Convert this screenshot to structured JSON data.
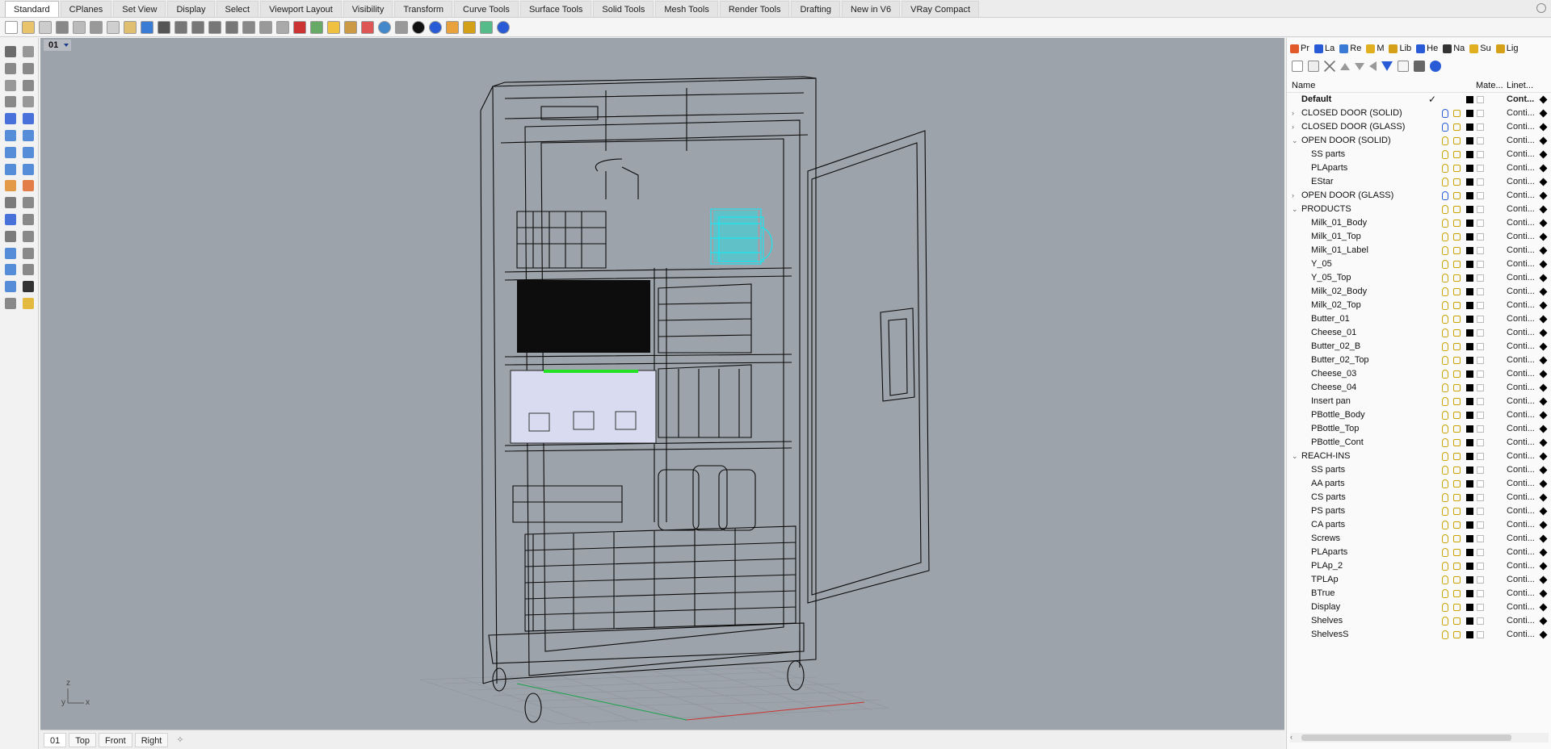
{
  "menu_tabs": [
    "Standard",
    "CPlanes",
    "Set View",
    "Display",
    "Select",
    "Viewport Layout",
    "Visibility",
    "Transform",
    "Curve Tools",
    "Surface Tools",
    "Solid Tools",
    "Mesh Tools",
    "Render Tools",
    "Drafting",
    "New in V6",
    "VRay Compact"
  ],
  "active_menu_tab": "Standard",
  "viewport": {
    "title": "01",
    "axis_z": "z",
    "axis_y": "y",
    "axis_x": "x"
  },
  "viewport_tabs": [
    "01",
    "Top",
    "Front",
    "Right"
  ],
  "panel": {
    "tabs": [
      "Pr",
      "La",
      "Re",
      "M",
      "Lib",
      "He",
      "Na",
      "Su",
      "Lig"
    ],
    "columns": {
      "name": "Name",
      "material": "Mate...",
      "linetype": "Linet..."
    },
    "layers": [
      {
        "name": "Default",
        "indent": 0,
        "current": true,
        "bold": true,
        "linetype": "Cont...",
        "expander": "",
        "bulb": "none"
      },
      {
        "name": "CLOSED DOOR (SOLID)",
        "indent": 0,
        "linetype": "Conti...",
        "expander": "›",
        "bulb": "blue"
      },
      {
        "name": "CLOSED DOOR (GLASS)",
        "indent": 0,
        "linetype": "Conti...",
        "expander": "›",
        "bulb": "blue"
      },
      {
        "name": "OPEN DOOR (SOLID)",
        "indent": 0,
        "linetype": "Conti...",
        "expander": "⌄",
        "bulb": "yellow"
      },
      {
        "name": "SS parts",
        "indent": 1,
        "linetype": "Conti...",
        "expander": "",
        "bulb": "yellow"
      },
      {
        "name": "PLAparts",
        "indent": 1,
        "linetype": "Conti...",
        "expander": "",
        "bulb": "yellow"
      },
      {
        "name": "EStar",
        "indent": 1,
        "linetype": "Conti...",
        "expander": "",
        "bulb": "yellow"
      },
      {
        "name": "OPEN DOOR (GLASS)",
        "indent": 0,
        "linetype": "Conti...",
        "expander": "›",
        "bulb": "blue"
      },
      {
        "name": "PRODUCTS",
        "indent": 0,
        "linetype": "Conti...",
        "expander": "⌄",
        "bulb": "yellow"
      },
      {
        "name": "Milk_01_Body",
        "indent": 1,
        "linetype": "Conti...",
        "expander": "",
        "bulb": "yellow"
      },
      {
        "name": "Milk_01_Top",
        "indent": 1,
        "linetype": "Conti...",
        "expander": "",
        "bulb": "yellow"
      },
      {
        "name": "Milk_01_Label",
        "indent": 1,
        "linetype": "Conti...",
        "expander": "",
        "bulb": "yellow"
      },
      {
        "name": "Y_05",
        "indent": 1,
        "linetype": "Conti...",
        "expander": "",
        "bulb": "yellow"
      },
      {
        "name": "Y_05_Top",
        "indent": 1,
        "linetype": "Conti...",
        "expander": "",
        "bulb": "yellow"
      },
      {
        "name": "Milk_02_Body",
        "indent": 1,
        "linetype": "Conti...",
        "expander": "",
        "bulb": "yellow"
      },
      {
        "name": "Milk_02_Top",
        "indent": 1,
        "linetype": "Conti...",
        "expander": "",
        "bulb": "yellow"
      },
      {
        "name": "Butter_01",
        "indent": 1,
        "linetype": "Conti...",
        "expander": "",
        "bulb": "yellow"
      },
      {
        "name": "Cheese_01",
        "indent": 1,
        "linetype": "Conti...",
        "expander": "",
        "bulb": "yellow"
      },
      {
        "name": "Butter_02_B",
        "indent": 1,
        "linetype": "Conti...",
        "expander": "",
        "bulb": "yellow"
      },
      {
        "name": "Butter_02_Top",
        "indent": 1,
        "linetype": "Conti...",
        "expander": "",
        "bulb": "yellow"
      },
      {
        "name": "Cheese_03",
        "indent": 1,
        "linetype": "Conti...",
        "expander": "",
        "bulb": "yellow"
      },
      {
        "name": "Cheese_04",
        "indent": 1,
        "linetype": "Conti...",
        "expander": "",
        "bulb": "yellow"
      },
      {
        "name": "Insert pan",
        "indent": 1,
        "linetype": "Conti...",
        "expander": "",
        "bulb": "yellow"
      },
      {
        "name": "PBottle_Body",
        "indent": 1,
        "linetype": "Conti...",
        "expander": "",
        "bulb": "yellow"
      },
      {
        "name": "PBottle_Top",
        "indent": 1,
        "linetype": "Conti...",
        "expander": "",
        "bulb": "yellow"
      },
      {
        "name": "PBottle_Cont",
        "indent": 1,
        "linetype": "Conti...",
        "expander": "",
        "bulb": "yellow"
      },
      {
        "name": "REACH-INS",
        "indent": 0,
        "linetype": "Conti...",
        "expander": "⌄",
        "bulb": "yellow"
      },
      {
        "name": "SS parts",
        "indent": 1,
        "linetype": "Conti...",
        "expander": "",
        "bulb": "yellow"
      },
      {
        "name": "AA parts",
        "indent": 1,
        "linetype": "Conti...",
        "expander": "",
        "bulb": "yellow"
      },
      {
        "name": "CS parts",
        "indent": 1,
        "linetype": "Conti...",
        "expander": "",
        "bulb": "yellow"
      },
      {
        "name": "PS parts",
        "indent": 1,
        "linetype": "Conti...",
        "expander": "",
        "bulb": "yellow"
      },
      {
        "name": "CA parts",
        "indent": 1,
        "linetype": "Conti...",
        "expander": "",
        "bulb": "yellow"
      },
      {
        "name": "Screws",
        "indent": 1,
        "linetype": "Conti...",
        "expander": "",
        "bulb": "yellow"
      },
      {
        "name": "PLAparts",
        "indent": 1,
        "linetype": "Conti...",
        "expander": "",
        "bulb": "yellow"
      },
      {
        "name": "PLAp_2",
        "indent": 1,
        "linetype": "Conti...",
        "expander": "",
        "bulb": "yellow"
      },
      {
        "name": "TPLAp",
        "indent": 1,
        "linetype": "Conti...",
        "expander": "",
        "bulb": "yellow"
      },
      {
        "name": "BTrue",
        "indent": 1,
        "linetype": "Conti...",
        "expander": "",
        "bulb": "yellow"
      },
      {
        "name": "Display",
        "indent": 1,
        "linetype": "Conti...",
        "expander": "",
        "bulb": "yellow"
      },
      {
        "name": "Shelves",
        "indent": 1,
        "linetype": "Conti...",
        "expander": "",
        "bulb": "yellow"
      },
      {
        "name": "ShelvesS",
        "indent": 1,
        "linetype": "Conti...",
        "expander": "",
        "bulb": "yellow"
      }
    ]
  },
  "colors": {
    "viewport_bg": "#9da3aa",
    "cyan_highlight": "#19e6f0",
    "green_highlight": "#22e022",
    "bulb": "#c9a400"
  }
}
